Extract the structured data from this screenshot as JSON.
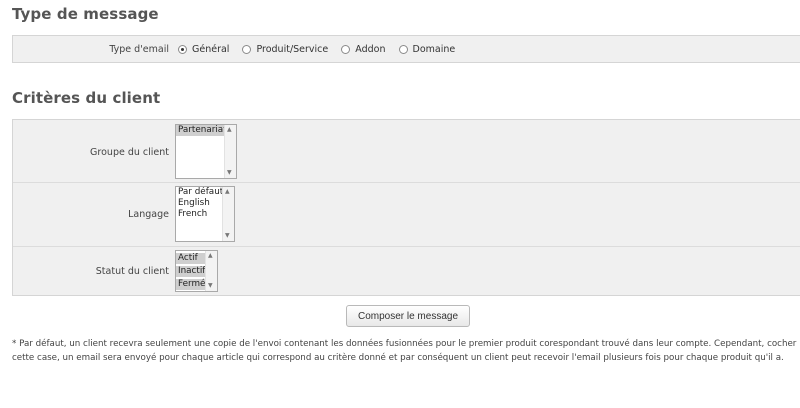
{
  "message_type": {
    "heading": "Type de message",
    "label": "Type d'email",
    "options": [
      "Général",
      "Produit/Service",
      "Addon",
      "Domaine"
    ],
    "selected": "Général"
  },
  "client_criteria": {
    "heading": "Critères du client",
    "group": {
      "label": "Groupe du client",
      "options": [
        "Partenariat"
      ],
      "selected": [
        "Partenariat"
      ]
    },
    "language": {
      "label": "Langage",
      "options": [
        "Par défaut",
        "English",
        "French"
      ],
      "selected": []
    },
    "status": {
      "label": "Statut du client",
      "options": [
        "Actif",
        "Inactif",
        "Fermé"
      ],
      "selected": [
        "Actif",
        "Inactif",
        "Fermé"
      ]
    }
  },
  "compose_button": "Composer le message",
  "footnote": "* Par défaut, un client recevra seulement une copie de l'envoi contenant les données fusionnées pour le premier produit corespondant trouvé dans leur compte. Cependant, cocher cette case, un email sera envoyé pour chaque article qui correspond au critère donné et par conséquent un client peut recevoir l'email plusieurs fois pour chaque produit qu'il a."
}
